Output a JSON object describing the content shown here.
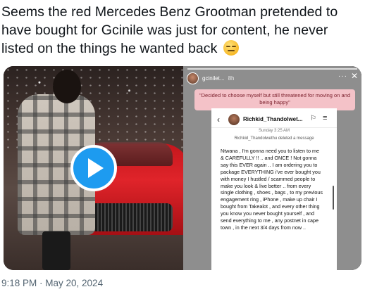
{
  "tweet": {
    "text": "Seems the red Mercedes Benz Grootman pretended to have bought for Gcinile was just for content, he never listed on the things he wanted back",
    "emoji_icon": "expressionless-face-icon",
    "timestamp": "9:18 PM · May 20, 2024"
  },
  "media": {
    "play_icon": "play-icon",
    "accent_color": "#1d9bf0",
    "story": {
      "username": "gcinilet...",
      "time": "8h",
      "caption": "\"Decided to choose myself but still threatened for moving on and being happy\"",
      "caption_bg": "#f4c2c8"
    },
    "chat": {
      "contact_name": "Richkid_Thandolwet...",
      "date_label": "Sunday 3:25 AM",
      "deleted_notice": "Richkid_Thandolwethu deleted a message",
      "message": "Ntwana , I'm gonna need you to listen to me & CAREFULLY !! .. and ONCE ! Not gonna say this EVER again .. I am ordering you to package EVERYTHING i've ever bought you with money I hustled / scammed people to make you look & live better .. from every single clothing , shoes , bags , to my previous engagement ring , iPhone , make up chair I bought from Takealot , and every other thing you know you never bought yourself , and send everything to me , any postnet in cape town , in the next 3/4 days from now .."
    }
  }
}
